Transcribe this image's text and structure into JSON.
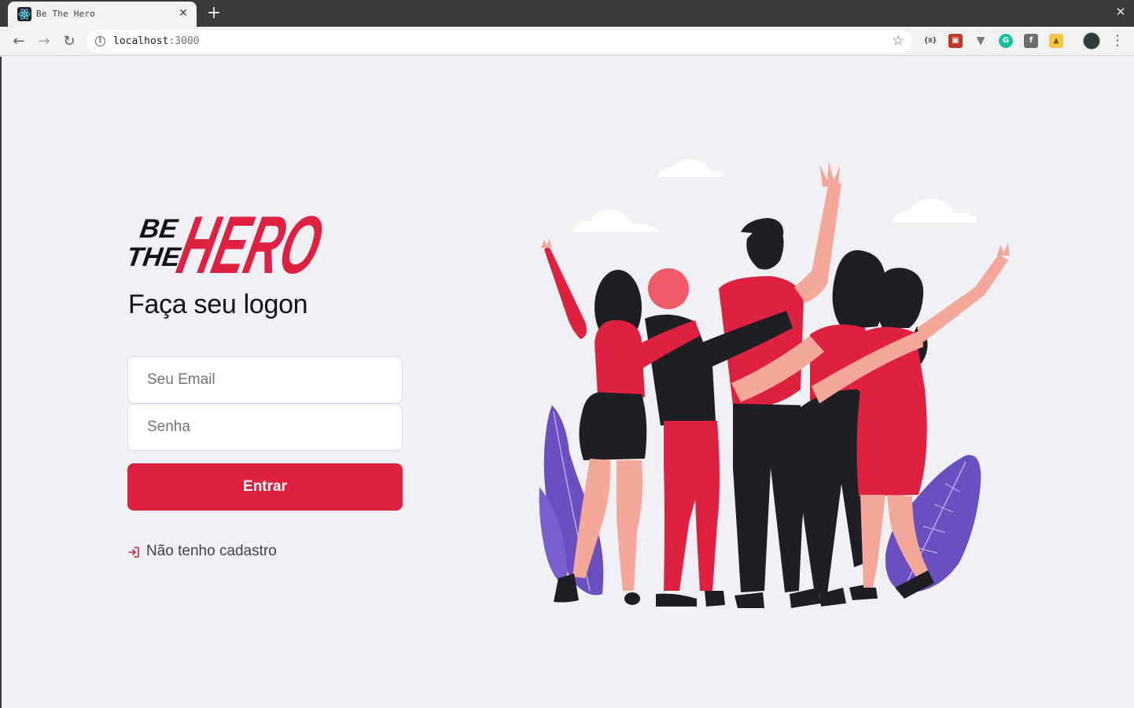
{
  "browser": {
    "tab_title": "Be The Hero",
    "url_host": "localhost",
    "url_port": ":3000",
    "icons": [
      "react-icon",
      "close-icon",
      "plus-icon",
      "back-icon",
      "forward-icon",
      "reload-icon",
      "info-icon",
      "star-icon",
      "menu-icon"
    ]
  },
  "extensions": {
    "json": "{≡}",
    "red": "▣",
    "vue": "▼",
    "g": "G",
    "f": "f",
    "lock": "🔒"
  },
  "logo": {
    "be": "BE",
    "the": "THE",
    "hero": "HERO"
  },
  "login": {
    "title": "Faça seu logon",
    "email_placeholder": "Seu Email",
    "password_placeholder": "Senha",
    "submit_label": "Entrar",
    "register_link": "Não tenho cadastro"
  },
  "colors": {
    "brand_red": "#e02041",
    "background": "#f0f0f5",
    "text_dark": "#13131a",
    "purple_leaves": "#6b4fc0"
  }
}
